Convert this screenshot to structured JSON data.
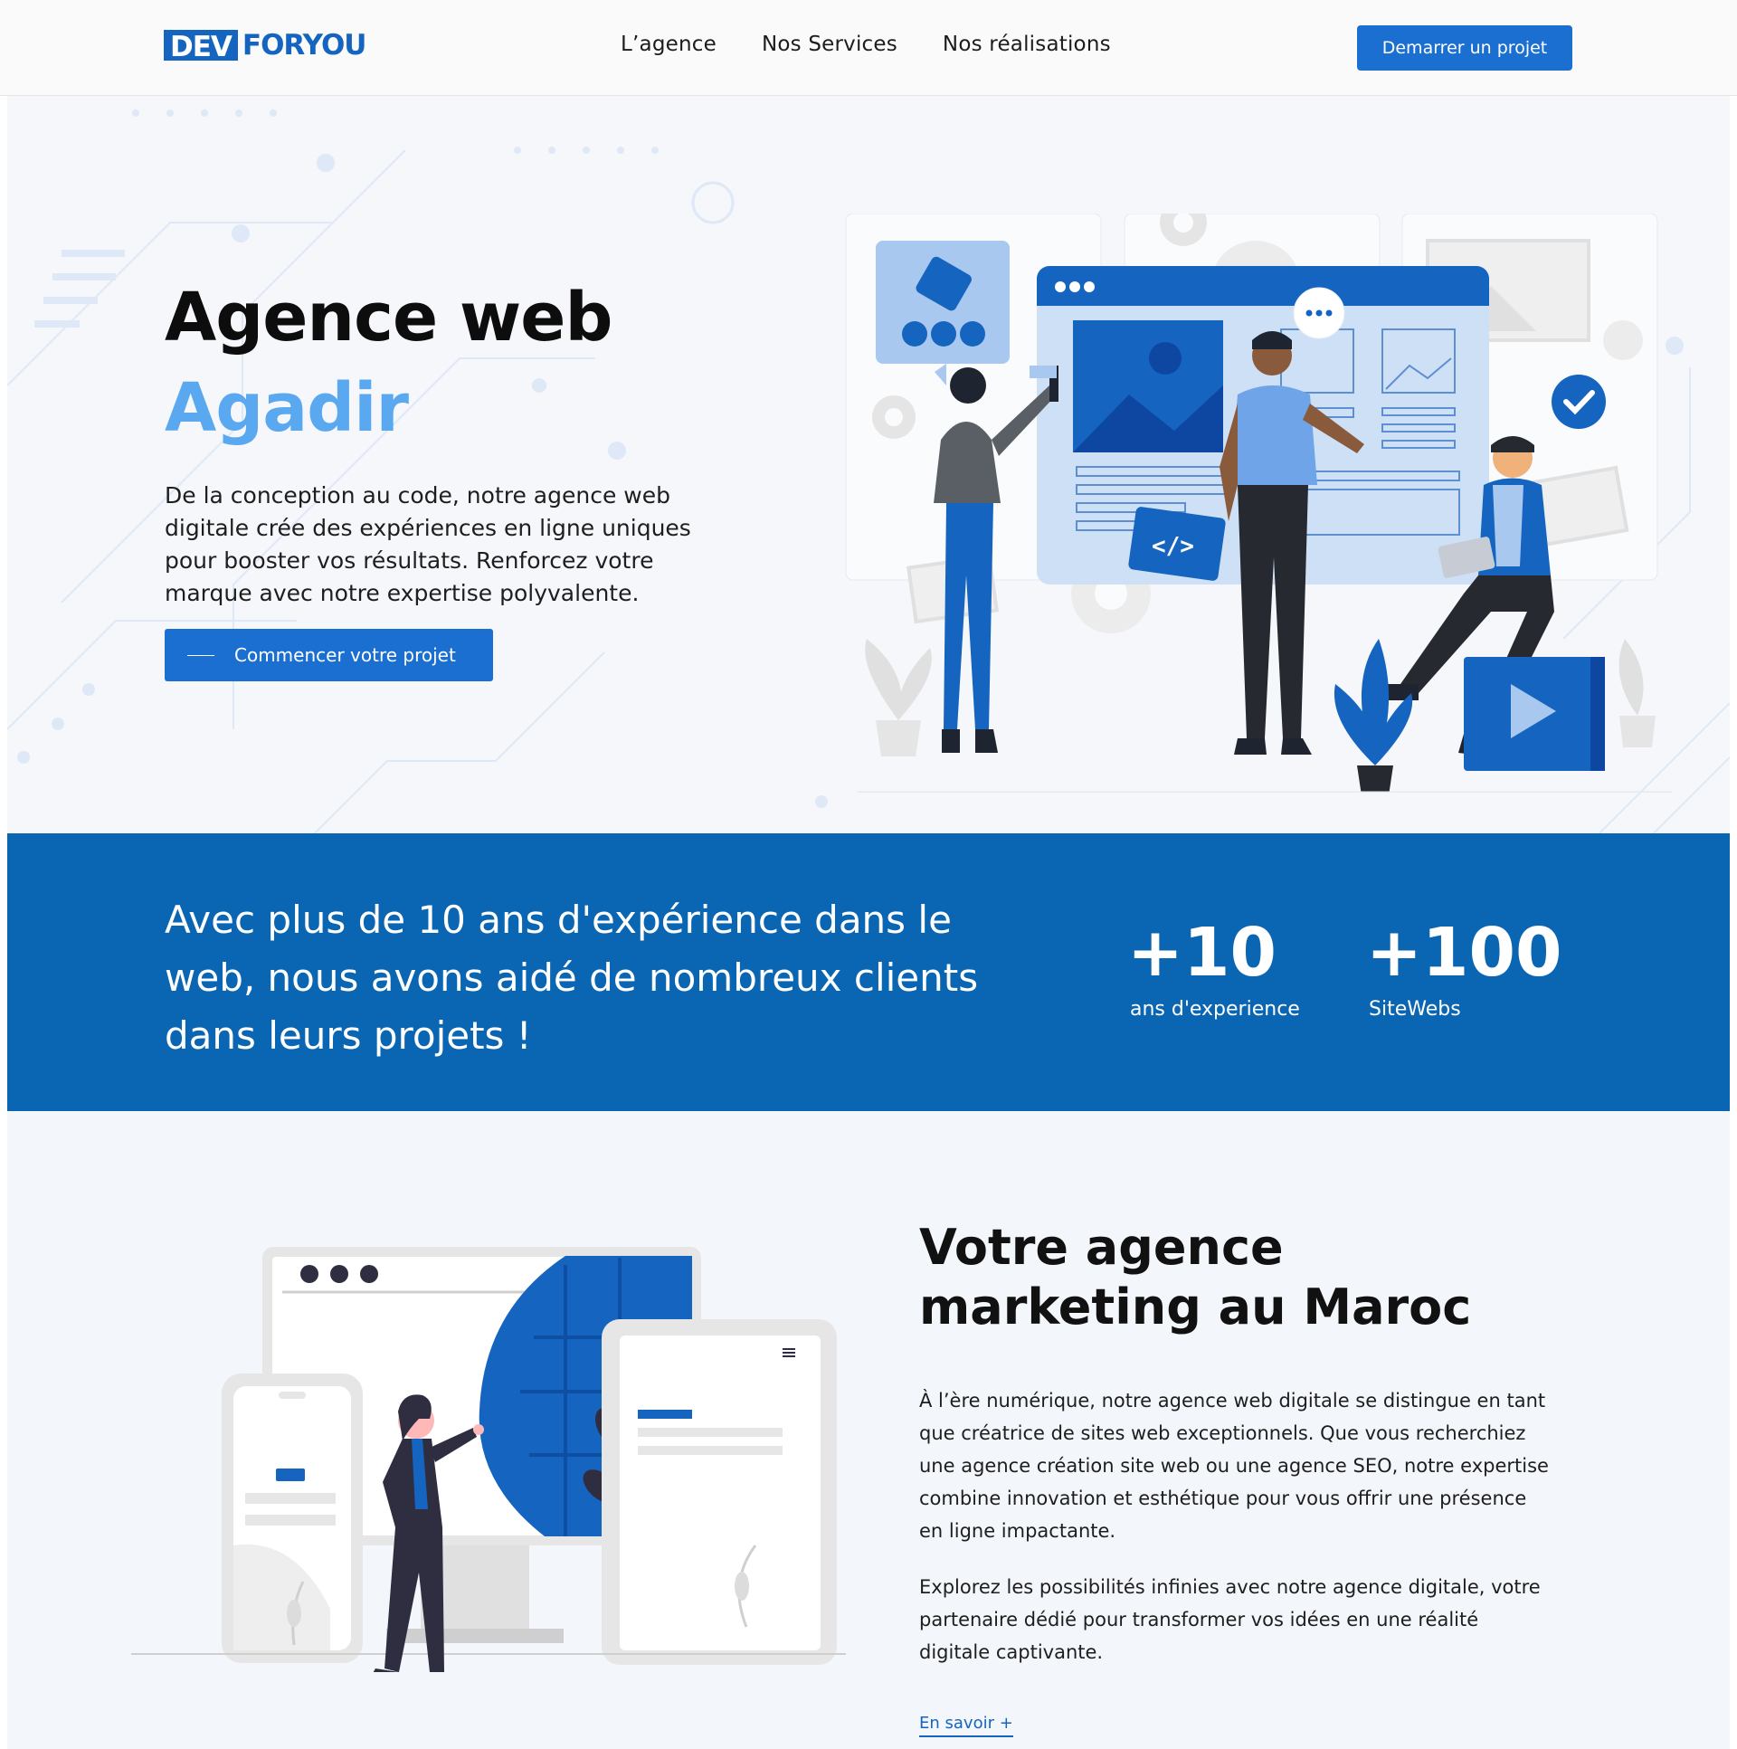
{
  "brand": {
    "logo_part1": "DEV",
    "logo_part2": "FORYOU",
    "primary_color": "#1a6fd1",
    "accent_color": "#5aa9f0",
    "band_color": "#0a66b2"
  },
  "nav": {
    "items": [
      "L’agence",
      "Nos Services",
      "Nos réalisations"
    ]
  },
  "header": {
    "cta_label": "Demarrer un projet"
  },
  "hero": {
    "title_line1": "Agence web",
    "title_line2": "Agadir",
    "description": "De la conception au code, notre agence web digitale crée des expériences en ligne uniques pour booster vos résultats. Renforcez votre marque avec notre expertise polyvalente.",
    "button_label": "Commencer votre projet"
  },
  "stats": {
    "headline": "Avec plus de 10 ans d'expérience dans le web, nous avons aidé de nombreux clients dans leurs projets !",
    "items": [
      {
        "value": "+10",
        "label": "ans d'experience"
      },
      {
        "value": "+100",
        "label": "SiteWebs"
      }
    ]
  },
  "marketing": {
    "title": "Votre agence marketing au Maroc",
    "paragraph1": "À l’ère numérique, notre agence web digitale se distingue en tant que créatrice de sites web exceptionnels. Que vous recherchiez une agence création site web ou une agence SEO, notre expertise combine innovation et esthétique pour vous offrir une présence en ligne impactante.",
    "paragraph2": "Explorez les possibilités infinies avec notre agence digitale, votre partenaire dédié pour transformer vos idées en une réalité digitale captivante.",
    "link_label": "En savoir +"
  }
}
